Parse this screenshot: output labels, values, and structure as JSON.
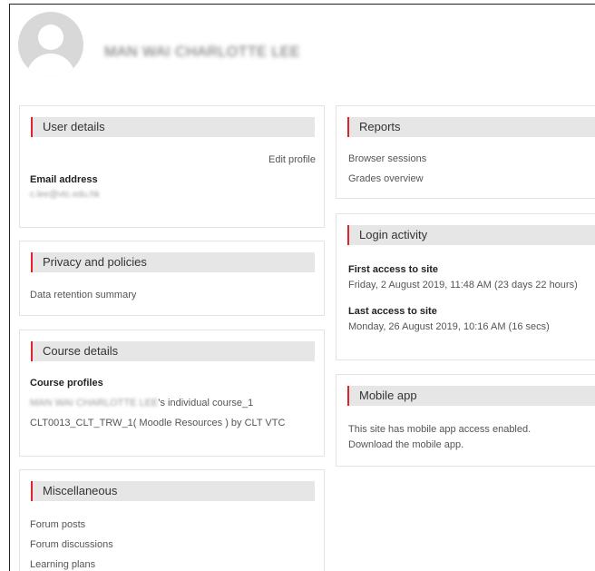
{
  "profile": {
    "name": "MAN WAI CHARLOTTE LEE"
  },
  "user_details": {
    "title": "User details",
    "edit_profile": "Edit profile",
    "email_label": "Email address",
    "email_value": "c.lee@vtc.edu.hk"
  },
  "privacy": {
    "title": "Privacy and policies",
    "data_retention": "Data retention summary"
  },
  "course_details": {
    "title": "Course details",
    "profiles_label": "Course profiles",
    "course1_owner": "MAN WAI CHARLOTTE LEE",
    "course1_suffix": "'s individual course_1",
    "course2": "CLT0013_CLT_TRW_1( Moodle Resources ) by CLT VTC"
  },
  "misc": {
    "title": "Miscellaneous",
    "forum_posts": "Forum posts",
    "forum_discussions": "Forum discussions",
    "learning_plans": "Learning plans"
  },
  "reports": {
    "title": "Reports",
    "browser_sessions": "Browser sessions",
    "grades_overview": "Grades overview"
  },
  "login_activity": {
    "title": "Login activity",
    "first_label": "First access to site",
    "first_value": "Friday, 2 August 2019, 11:48 AM  (23 days 22 hours)",
    "last_label": "Last access to site",
    "last_value": "Monday, 26 August 2019, 10:16 AM  (16 secs)"
  },
  "mobile_app": {
    "title": "Mobile app",
    "line1": "This site has mobile app access enabled.",
    "line2": "Download the mobile app."
  },
  "colors": {
    "accent": "#e4202d",
    "header_bg": "#e6e6e6",
    "border": "#e3e3e3"
  }
}
